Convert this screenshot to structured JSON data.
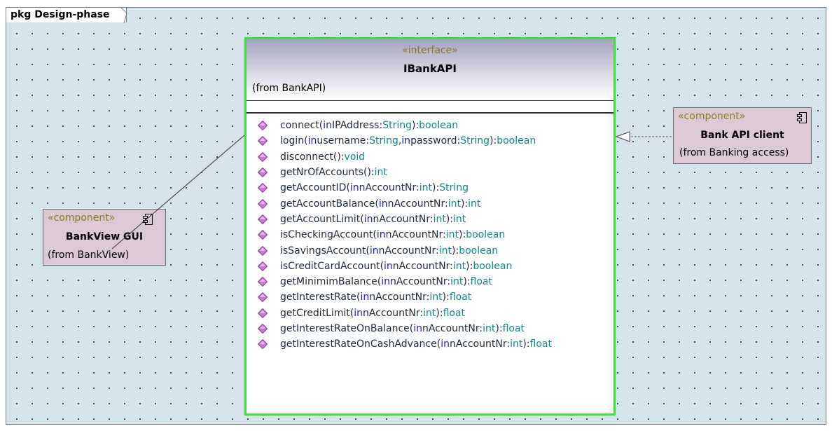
{
  "package": {
    "label": "pkg Design-phase"
  },
  "interface": {
    "stereotype": "«interface»",
    "name": "IBankAPI",
    "from": "(from BankAPI)",
    "operations": [
      {
        "name": "connect(",
        "params": [
          {
            "dir": "in",
            "text": " IPAddress:",
            "type": "String"
          }
        ],
        "ret": "boolean"
      },
      {
        "name": "login(",
        "params": [
          {
            "dir": "in",
            "text": " username:",
            "type": "String"
          },
          {
            "dir": "in",
            "text": " password:",
            "type": "String"
          }
        ],
        "ret": "boolean"
      },
      {
        "name": "disconnect(",
        "params": [],
        "ret": "void"
      },
      {
        "name": "getNrOfAccounts(",
        "params": [],
        "ret": "int"
      },
      {
        "name": "getAccountID(",
        "params": [
          {
            "dir": "in",
            "text": " nAccountNr:",
            "type": "int"
          }
        ],
        "ret": "String"
      },
      {
        "name": "getAccountBalance(",
        "params": [
          {
            "dir": "in",
            "text": " nAccountNr:",
            "type": "int"
          }
        ],
        "ret": "int"
      },
      {
        "name": "getAccountLimit(",
        "params": [
          {
            "dir": "in",
            "text": " nAccountNr:",
            "type": "int"
          }
        ],
        "ret": "int"
      },
      {
        "name": "isCheckingAccount(",
        "params": [
          {
            "dir": "in",
            "text": " nAccountNr:",
            "type": "int"
          }
        ],
        "ret": "boolean"
      },
      {
        "name": "isSavingsAccount(",
        "params": [
          {
            "dir": "in",
            "text": " nAccountNr:",
            "type": "int"
          }
        ],
        "ret": "boolean"
      },
      {
        "name": "isCreditCardAccount(",
        "params": [
          {
            "dir": "in",
            "text": " nAccountNr:",
            "type": "int"
          }
        ],
        "ret": "boolean"
      },
      {
        "name": "getMinimimBalance(",
        "params": [
          {
            "dir": "in",
            "text": " nAccountNr:",
            "type": "int"
          }
        ],
        "ret": "float"
      },
      {
        "name": "getInterestRate(",
        "params": [
          {
            "dir": "in",
            "text": " nAccountNr:",
            "type": "int"
          }
        ],
        "ret": "float"
      },
      {
        "name": "getCreditLimit(",
        "params": [
          {
            "dir": "in",
            "text": " nAccountNr:",
            "type": "int"
          }
        ],
        "ret": "float"
      },
      {
        "name": "getInterestRateOnBalance(",
        "params": [
          {
            "dir": "in",
            "text": " nAccountNr:",
            "type": "int"
          }
        ],
        "ret": "float"
      },
      {
        "name": "getInterestRateOnCashAdvance(",
        "params": [
          {
            "dir": "in",
            "text": " nAccountNr:",
            "type": "int"
          }
        ],
        "ret": "float"
      }
    ]
  },
  "components": {
    "client": {
      "stereotype": "«component»",
      "name": "Bank API client",
      "from": "(from Banking access)"
    },
    "gui": {
      "stereotype": "«component»",
      "name": "BankView GUI",
      "from": "(from BankView)"
    }
  },
  "colors": {
    "canvas": "#d5e3ea",
    "selection_border": "#33e633",
    "component_fill": "#ddc9d6",
    "stereotype_text": "#8a7a1e",
    "keyword_in": "#1a1acc",
    "type_text": "#0e8a8a",
    "operation_icon": "#c77ad0"
  },
  "icons": {
    "operation": "operation-diamond-icon",
    "component": "component-icon"
  }
}
